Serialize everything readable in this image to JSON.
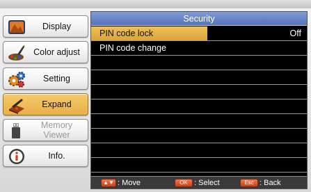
{
  "menu": {
    "items": [
      {
        "label": "Display",
        "icon": "display-icon"
      },
      {
        "label": "Color adjust",
        "icon": "color-adjust-icon"
      },
      {
        "label": "Setting",
        "icon": "setting-icon"
      },
      {
        "label": "Expand",
        "icon": "expand-icon",
        "active": true
      },
      {
        "label": "Memory Viewer",
        "icon": "memory-viewer-icon",
        "disabled": true
      },
      {
        "label": "Info.",
        "icon": "info-icon"
      }
    ]
  },
  "panel": {
    "title": "Security",
    "rows": [
      {
        "label": "PIN code lock",
        "value": "Off",
        "selected": true
      },
      {
        "label": "PIN code change",
        "value": ""
      }
    ]
  },
  "footer": {
    "move": {
      "key": "▲▼",
      "label": ": Move"
    },
    "select": {
      "key": "OK",
      "label": ": Select"
    },
    "back": {
      "key": "Esc",
      "label": ": Back"
    }
  },
  "colors": {
    "highlight": "#e8b04a",
    "title_bar": "#5573b8",
    "panel_bg": "#000000",
    "key_orange": "#d94f24"
  }
}
